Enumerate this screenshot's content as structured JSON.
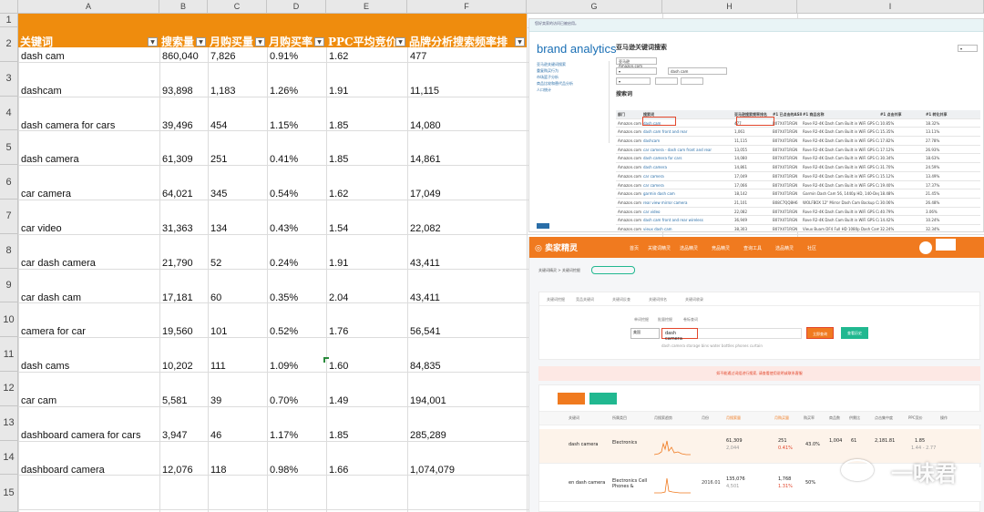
{
  "sheet": {
    "col_letters": [
      "A",
      "B",
      "C",
      "D",
      "E",
      "F",
      "G",
      "H",
      "I"
    ],
    "row_numbers": [
      "1",
      "2",
      "3",
      "4",
      "5",
      "6",
      "7",
      "8",
      "9",
      "10",
      "11",
      "12",
      "13",
      "14",
      "15"
    ],
    "headers": [
      "关键词",
      "搜索量",
      "月购买量",
      "月购买率",
      "PPC平均竞价",
      "品牌分析搜索频率排"
    ],
    "header_bg": "#ef8c0d",
    "rows": [
      [
        "dash cam",
        "860,040",
        "7,826",
        "0.91%",
        "1.62",
        "477"
      ],
      [
        "dashcam",
        "93,898",
        "1,183",
        "1.26%",
        "1.91",
        "11,115"
      ],
      [
        "dash camera for cars",
        "39,496",
        "454",
        "1.15%",
        "1.85",
        "14,080"
      ],
      [
        "dash camera",
        "61,309",
        "251",
        "0.41%",
        "1.85",
        "14,861"
      ],
      [
        "car camera",
        "64,021",
        "345",
        "0.54%",
        "1.62",
        "17,049"
      ],
      [
        "car video",
        "31,363",
        "134",
        "0.43%",
        "1.54",
        "22,082"
      ],
      [
        "car dash camera",
        "21,790",
        "52",
        "0.24%",
        "1.91",
        "43,411"
      ],
      [
        "car dash cam",
        "17,181",
        "60",
        "0.35%",
        "2.04",
        "43,411"
      ],
      [
        "camera for car",
        "19,560",
        "101",
        "0.52%",
        "1.76",
        "56,541"
      ],
      [
        "dash cams",
        "10,202",
        "111",
        "1.09%",
        "1.60",
        "84,835"
      ],
      [
        "car cam",
        "5,581",
        "39",
        "0.70%",
        "1.49",
        "194,001"
      ],
      [
        "dashboard camera for cars",
        "3,947",
        "46",
        "1.17%",
        "1.85",
        "285,289"
      ],
      [
        "dashboard camera",
        "12,076",
        "118",
        "0.98%",
        "1.66",
        "1,074,079"
      ]
    ]
  },
  "brand_analytics": {
    "logo": "brand analytics",
    "page_title": "亚马逊关键词搜索",
    "banner": "您好卖家的访问已被启用。",
    "marketplace": "亚马逊 Amazon.com",
    "search_value": "dash cam",
    "section_label": "搜索词",
    "nav_items": [
      "亚马逊关键词搜索",
      "重复购买行为",
      "市场篮子分析",
      "商品比较和替代品分析",
      "人口统计"
    ],
    "table_header": [
      "部门",
      "搜索词",
      "亚马逊搜索频率排名",
      "#1 已点击的ASIN",
      "#1 商品名称",
      "#1 点击共享",
      "#1 转化共享"
    ],
    "table_rows": [
      [
        "Amazon.com",
        "dash cam",
        "477",
        "B07X471RGN",
        "Rove R2-4K Dash Cam Built in WiFi GPS Car Dashboard Camera",
        "10.85%",
        "18.32%"
      ],
      [
        "Amazon.com",
        "dash cam front and rear",
        "1,061",
        "B07X471RGN",
        "Rove R2-4K Dash Cam Built in WiFi GPS Car Dashboard Camera",
        "15.35%",
        "13.11%"
      ],
      [
        "Amazon.com",
        "dashcam",
        "11,115",
        "B07X471RGN",
        "Rove R2-4K Dash Cam Built in WiFi GPS Car Dashboard Camera",
        "17.82%",
        "27.78%"
      ],
      [
        "Amazon.com",
        "car camera - dash cam front and rear",
        "13,055",
        "B07X471RGN",
        "Rove R2-4K Dash Cam Built in WiFi GPS Car Dashboard Camera",
        "17.12%",
        "26.93%"
      ],
      [
        "Amazon.com",
        "dash camera for cars",
        "14,080",
        "B07X471RGN",
        "Rove R2-4K Dash Cam Built in WiFi GPS Car Dashboard Camera",
        "30.34%",
        "18.63%"
      ],
      [
        "Amazon.com",
        "dash camera",
        "14,861",
        "B07X471RGN",
        "Rove R2-4K Dash Cam Built in WiFi GPS Car Dashboard Camera",
        "31.70%",
        "24.59%"
      ],
      [
        "Amazon.com",
        "car camera",
        "17,049",
        "B07X471RGN",
        "Rove R2-4K Dash Cam Built in WiFi GPS Car Dashboard Camera",
        "15.12%",
        "13.49%"
      ],
      [
        "Amazon.com",
        "car camera",
        "17,066",
        "B07X471RGN",
        "Rove R2-4K Dash Cam Built in WiFi GPS Car Dashboard Camera",
        "19.40%",
        "17.37%"
      ],
      [
        "Amazon.com",
        "garmin dash cam",
        "18,142",
        "B07X471RGN",
        "Garmin Dash Cam 56, 1440p HD, 140-Degree Field of View",
        "18.48%",
        "21.45%"
      ],
      [
        "Amazon.com",
        "rear view mirror camera",
        "21,101",
        "B08C7QQ8H6",
        "WOLFBOX 12\" Mirror Dash Cam Backup Camera 2.5K",
        "30.06%",
        "26.48%"
      ],
      [
        "Amazon.com",
        "car video",
        "22,082",
        "B07X471RGN",
        "Rove R2-4K Dash Cam Built in WiFi GPS Car Dashboard Camera",
        "40.79%",
        "3.06%"
      ],
      [
        "Amazon.com",
        "dash cam front and rear wireless",
        "36,949",
        "B07X471RGN",
        "Rove R2-4K Dash Cam Built in WiFi GPS Car Dashboard Camera",
        "14.42%",
        "10.24%"
      ],
      [
        "Amazon.com",
        "vieux dash cam",
        "38,303",
        "B07X471RGN",
        "Vieux Buam DF4 Full HD 1080p Dash Cam | 2021 Model",
        "32.24%",
        "32.34%"
      ]
    ]
  },
  "seller_sprite": {
    "brand": "卖家精灵",
    "nav": [
      "首页",
      "关键词精灵",
      "选品精灵",
      "竞品精灵",
      "查询工具",
      "选品精灵",
      "社区"
    ],
    "breadcrumb": "关键词精灵 > 关键词挖掘",
    "tabs": [
      "关键词挖掘",
      "竞品关键词",
      "关键词反查",
      "关键词排名",
      "关键词收录",
      "关键词导出"
    ],
    "search_modes": [
      "单词挖掘",
      "批量挖掘",
      "卷标查词"
    ],
    "marketplace": "美国",
    "search_value": "dash camera",
    "search_button": "立即查询",
    "export_button": "查看历史",
    "suggestions": "dash camera  storage bins  water bottles  phones  curtain",
    "notice": "如不能通过词组进行搜索, 请查看使用说明或联系客服",
    "table_header": [
      "关键词",
      "所属类目",
      "月搜索趋势",
      "月份",
      "月搜索量",
      "月购买量",
      "购买率",
      "商品数",
      "供需比",
      "点击集中度",
      "PPC竞价",
      "操作"
    ],
    "rows": [
      {
        "keyword": "dash camera",
        "category": "Electronics",
        "month": "",
        "search": "61,309",
        "search_sub": "2,044",
        "purchase": "251",
        "purchase_sub": "0.41%",
        "rate": "43.0%",
        "products": "1,004",
        "ratio": "61",
        "concentration": "2,181.81",
        "ppc": "1.85",
        "ppc_sub": "1.44 - 2.77"
      },
      {
        "keyword": "en dash camera",
        "category": "Electronics Cell Phones &",
        "month": "2016.01",
        "search": "135,076",
        "search_sub": "4,501",
        "purchase": "1,768",
        "purchase_sub": "1.31%",
        "rate": "50%",
        "products": "",
        "ratio": "",
        "concentration": "",
        "ppc": "",
        "ppc_sub": ""
      }
    ]
  },
  "watermark": "一味君"
}
